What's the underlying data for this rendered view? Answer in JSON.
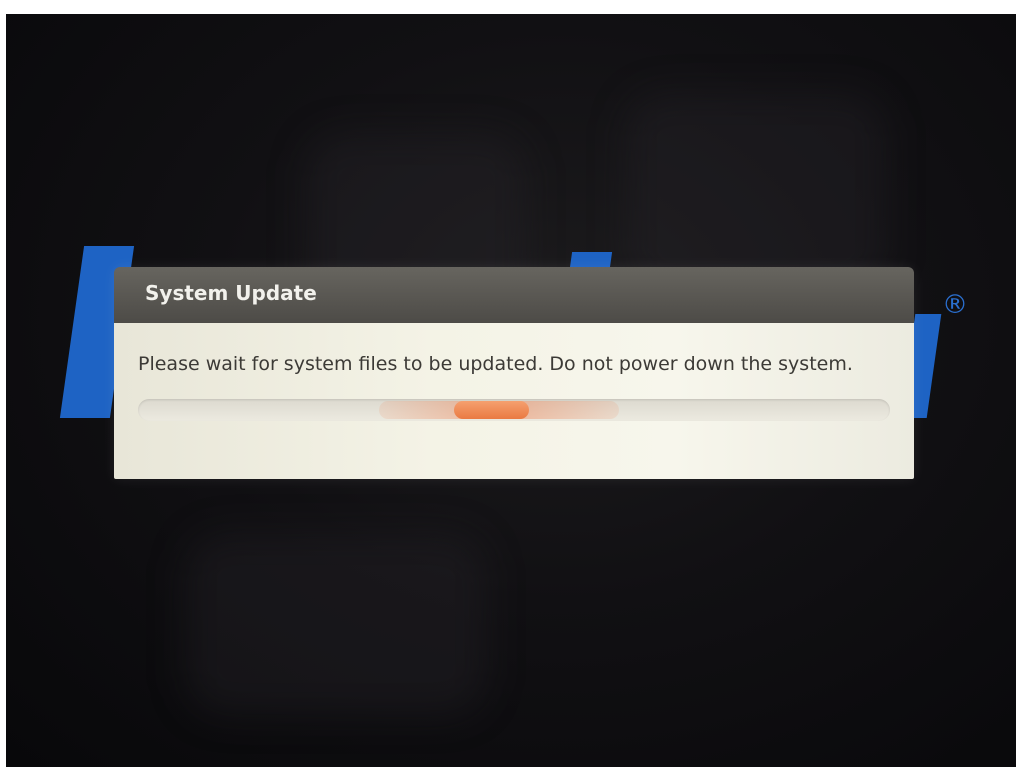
{
  "dialog": {
    "title": "System Update",
    "message": "Please wait for system files to be updated. Do not power down the system.",
    "progress": {
      "type": "indeterminate-pulse",
      "active_center_fraction": 0.47,
      "active_width_fraction": 0.1
    }
  },
  "background": {
    "logo_mark": "®",
    "logo_color": "#1e63c4"
  },
  "colors": {
    "titlebar": "#58564f",
    "dialog_body": "#f4f3e6",
    "progress_accent": "#ea7a42"
  }
}
